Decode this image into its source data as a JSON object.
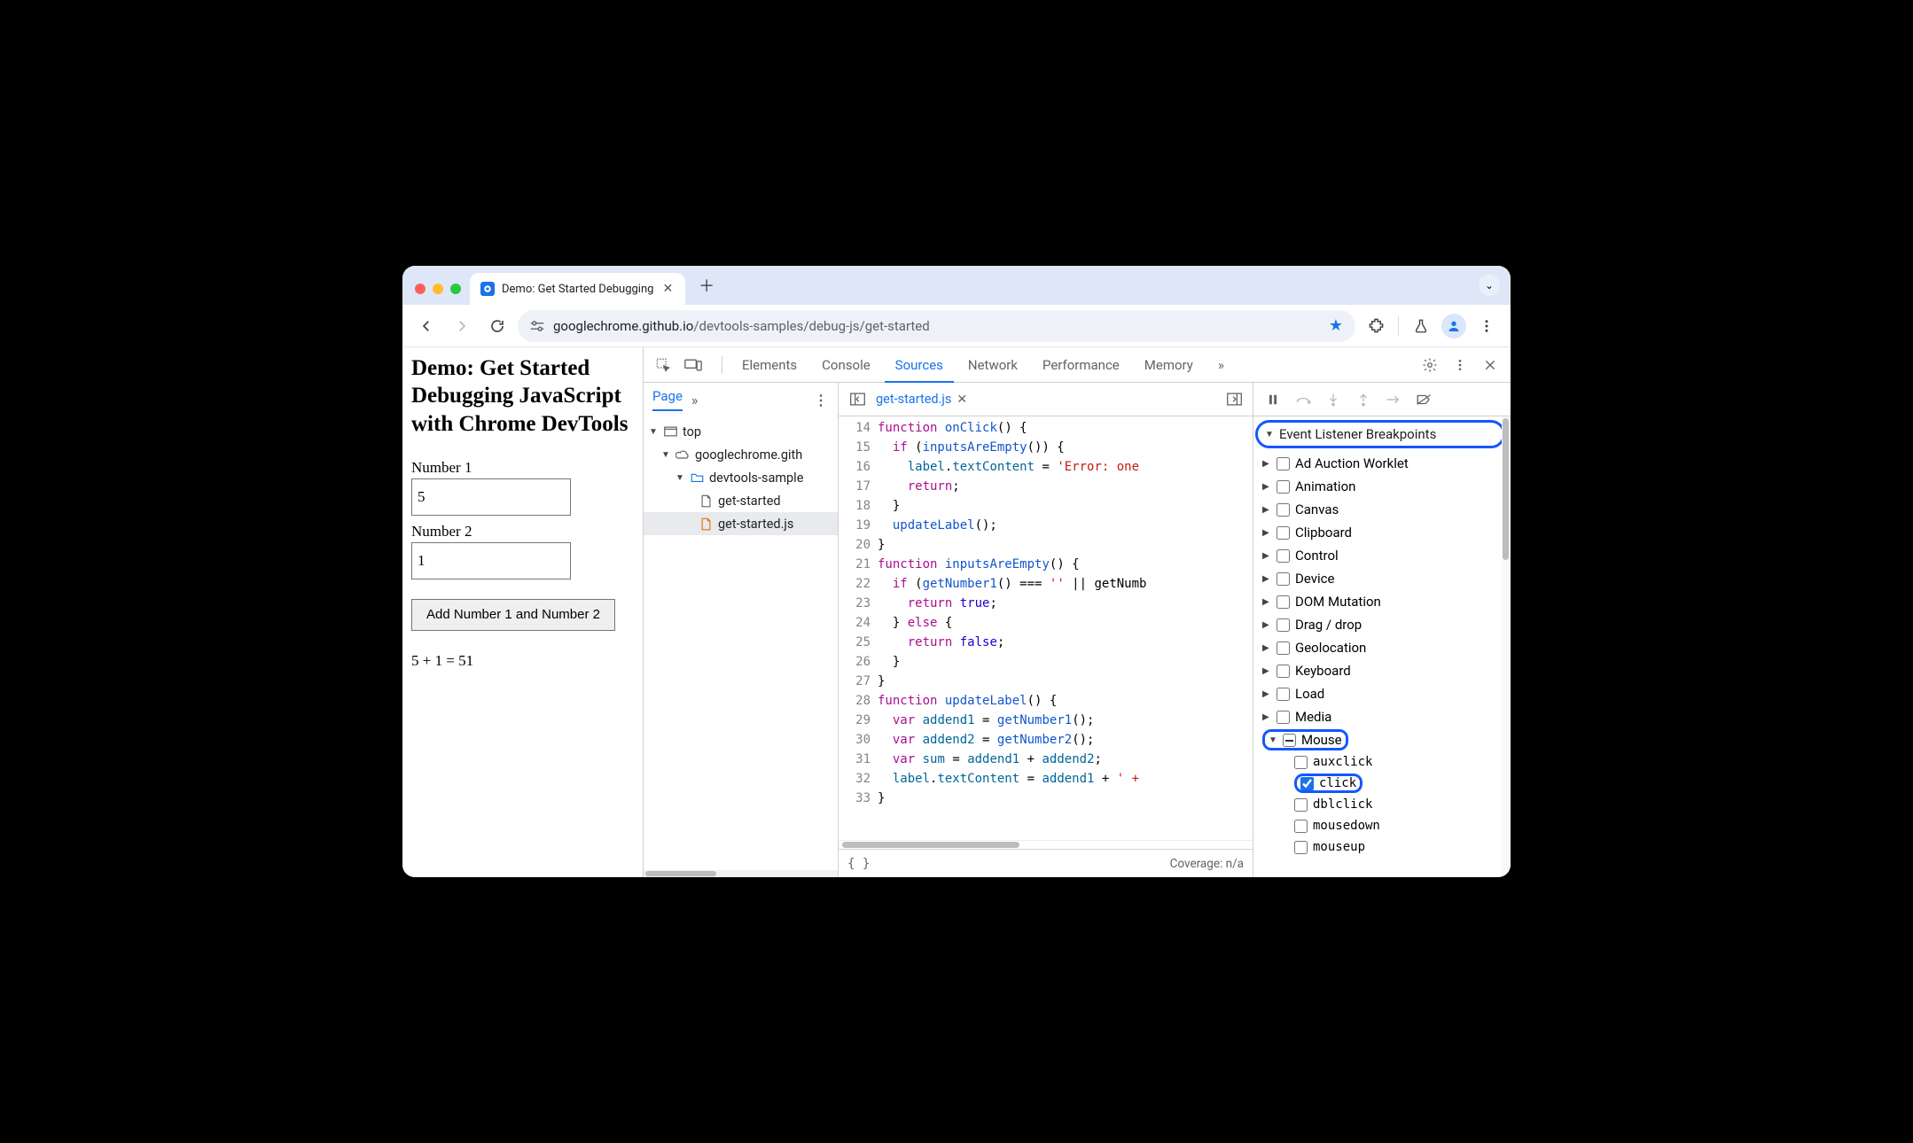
{
  "browser": {
    "tab_title": "Demo: Get Started Debugging",
    "url_host": "googlechrome.github.io",
    "url_path": "/devtools-samples/debug-js/get-started"
  },
  "page": {
    "heading": "Demo: Get Started Debugging JavaScript with Chrome DevTools",
    "label1": "Number 1",
    "value1": "5",
    "label2": "Number 2",
    "value2": "1",
    "button": "Add Number 1 and Number 2",
    "result": "5 + 1 = 51"
  },
  "devtools": {
    "tabs": [
      "Elements",
      "Console",
      "Sources",
      "Network",
      "Performance",
      "Memory"
    ],
    "active_tab": "Sources",
    "nav": {
      "subtab": "Page",
      "tree": {
        "top": "top",
        "domain": "googlechrome.gith",
        "folder": "devtools-sample",
        "file_html": "get-started",
        "file_js": "get-started.js"
      }
    },
    "editor": {
      "open_file": "get-started.js",
      "first_line_no": 14,
      "lines_plain": [
        "function onClick() {",
        "  if (inputsAreEmpty()) {",
        "    label.textContent = 'Error: one",
        "    return;",
        "  }",
        "  updateLabel();",
        "}",
        "function inputsAreEmpty() {",
        "  if (getNumber1() === '' || getNumb",
        "    return true;",
        "  } else {",
        "    return false;",
        "  }",
        "}",
        "function updateLabel() {",
        "  var addend1 = getNumber1();",
        "  var addend2 = getNumber2();",
        "  var sum = addend1 + addend2;",
        "  label.textContent = addend1 + ' +",
        "}"
      ],
      "coverage": "Coverage: n/a"
    },
    "breakpoints": {
      "section": "Event Listener Breakpoints",
      "categories": [
        {
          "name": "Ad Auction Worklet",
          "expanded": false,
          "checked": false
        },
        {
          "name": "Animation",
          "expanded": false,
          "checked": false
        },
        {
          "name": "Canvas",
          "expanded": false,
          "checked": false
        },
        {
          "name": "Clipboard",
          "expanded": false,
          "checked": false
        },
        {
          "name": "Control",
          "expanded": false,
          "checked": false
        },
        {
          "name": "Device",
          "expanded": false,
          "checked": false
        },
        {
          "name": "DOM Mutation",
          "expanded": false,
          "checked": false
        },
        {
          "name": "Drag / drop",
          "expanded": false,
          "checked": false
        },
        {
          "name": "Geolocation",
          "expanded": false,
          "checked": false
        },
        {
          "name": "Keyboard",
          "expanded": false,
          "checked": false
        },
        {
          "name": "Load",
          "expanded": false,
          "checked": false
        },
        {
          "name": "Media",
          "expanded": false,
          "checked": false
        },
        {
          "name": "Mouse",
          "expanded": true,
          "checked": "indeterminate",
          "events": [
            {
              "name": "auxclick",
              "checked": false
            },
            {
              "name": "click",
              "checked": true
            },
            {
              "name": "dblclick",
              "checked": false
            },
            {
              "name": "mousedown",
              "checked": false
            },
            {
              "name": "mouseup",
              "checked": false
            }
          ]
        }
      ]
    }
  }
}
